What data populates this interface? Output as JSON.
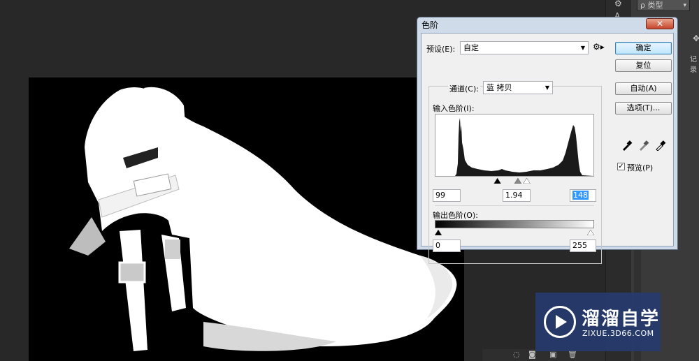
{
  "dialog": {
    "title": "色阶",
    "close_label": "✕",
    "preset_label": "预设(E):",
    "preset_value": "自定",
    "channel_label": "通道(C):",
    "channel_value": "蓝 拷贝",
    "input_levels_label": "输入色阶(I):",
    "input_black": "99",
    "input_gamma": "1.94",
    "input_white": "148",
    "output_levels_label": "输出色阶(O):",
    "output_black": "0",
    "output_white": "255",
    "buttons": {
      "ok": "确定",
      "reset": "复位",
      "auto": "自动(A)",
      "options": "选项(T)..."
    },
    "preview_label": "预览(P)",
    "preview_checked": "✓",
    "slider_levels": {
      "input_black": 99,
      "input_gamma": 1.94,
      "input_white": 148,
      "output_black": 0,
      "output_white": 255,
      "max": 255
    }
  },
  "panel": {
    "search_placeholder": "ρ 类型",
    "tab_label": "记录"
  },
  "watermark": {
    "name": "溜溜自学",
    "url": "ZIXUE.3D66.COM"
  },
  "icons": {
    "eyedropper_black": "eyedropper-black-icon",
    "eyedropper_gray": "eyedropper-gray-icon",
    "eyedropper_white": "eyedropper-white-icon",
    "gear": "gear-icon"
  },
  "colors": {
    "dialog_frame": "#cfdbe9",
    "default_button": "#bee6fd",
    "close_button": "#c7442b",
    "watermark_bg": "#263a6e"
  }
}
